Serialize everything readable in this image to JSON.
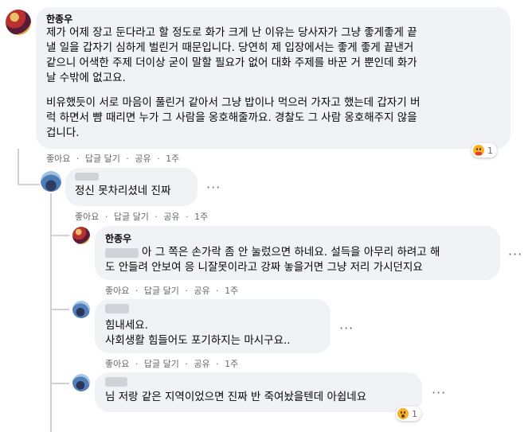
{
  "comment1": {
    "author": "한종우",
    "para1": [
      "제가 어제 장고 둔다라고 할 정도로 화가 크게 난 이유는 당사자가 그냥 좋게좋게 끝",
      "낼 일을 갑자기 심하게 벌린거 때문입니다. 당연히 제 입장에서는 좋게 좋게 끝낸거",
      "같으니 어색한 주제 더이상 굳이 말할 필요가 없어 대화 주제를 바꾼 거 뿐인데 화가",
      "날 수밖에 없고요."
    ],
    "para2": [
      "비유했듯이 서로 마음이 풀린거 같아서 그냥 밥이나 먹으러 가자고 했는데 갑자기 버",
      "럭 하면서 뺨 때리면 누가 그 사람을 옹호해줄까요. 경찰도 그 사람 옹호해주지 않을",
      "겁니다."
    ],
    "like": "좋아요",
    "reply": "답글 달기",
    "share": "공유",
    "time": "1주",
    "reaction_count": "1",
    "reaction_icon": "care-emoji-icon"
  },
  "reply1": {
    "text": "정신 못차리셨네 진짜",
    "like": "좋아요",
    "reply": "답글 달기",
    "share": "공유",
    "time": "1주"
  },
  "reply2": {
    "author": "한종우",
    "line1": "아 그 쪽은 손가락 좀 안 눌렀으면 하네요. 설득을 아무리 하려고 해",
    "line2": "도 안들려 안보여 응 니잘못이라고 강짜 놓을거면 그냥 저리 가시던지요",
    "like": "좋아요",
    "reply": "답글 달기",
    "share": "공유",
    "time": "1주"
  },
  "reply3": {
    "line1": "힘내세요.",
    "line2": "사회생활 힘들어도 포기하지는 마시구요..",
    "like": "좋아요",
    "reply": "답글 달기",
    "share": "공유",
    "time": "1주"
  },
  "reply4": {
    "text": "님 저랑 같은 지역이었으면 진짜 반 죽여놨을텐데 아쉽네요",
    "reaction_count": "1",
    "reaction_icon": "wow-emoji-icon"
  },
  "sep": "·",
  "more": "···"
}
